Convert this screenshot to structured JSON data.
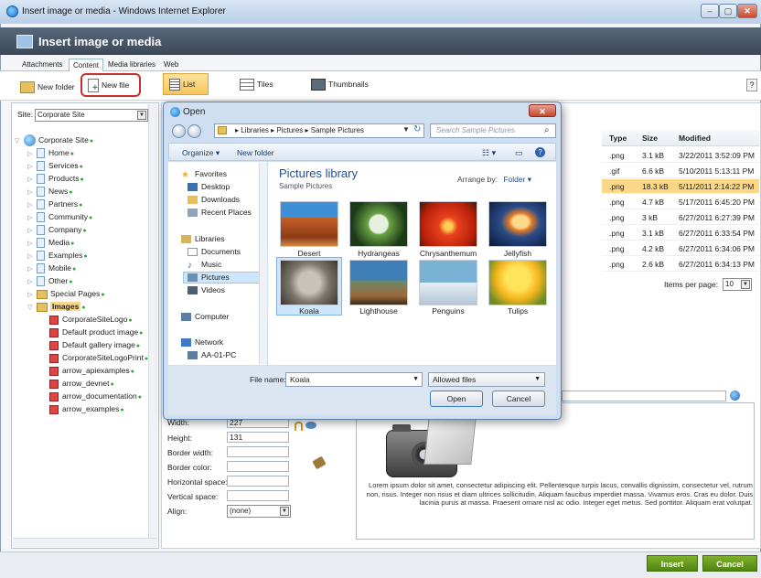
{
  "window": {
    "title": "Insert image or media - Windows Internet Explorer",
    "controls": [
      "–",
      "▢",
      "✕"
    ]
  },
  "dialog": {
    "title": "Insert image or media"
  },
  "tabs": [
    "Attachments",
    "Content",
    "Media libraries",
    "Web"
  ],
  "toolbar": {
    "new_folder": "New folder",
    "new_file": "New file",
    "list": "List",
    "tiles": "Tiles",
    "thumbnails": "Thumbnails",
    "help": "?"
  },
  "site": {
    "label": "Site:",
    "value": "Corporate Site"
  },
  "tree": {
    "root": "Corporate Site",
    "items": [
      "Home",
      "Services",
      "Products",
      "News",
      "Partners",
      "Community",
      "Company",
      "Media",
      "Examples",
      "Mobile",
      "Other",
      "Special Pages",
      "Images"
    ],
    "images": [
      "CorporateSiteLogo",
      "Default product image",
      "Default gallery image",
      "CorporateSiteLogoPrint",
      "arrow_apiexamples",
      "arrow_devnet",
      "arrow_documentation",
      "arrow_examples"
    ]
  },
  "grid": {
    "headers": {
      "type": "Type",
      "size": "Size",
      "modified": "Modified"
    },
    "rows": [
      {
        "type": ".png",
        "size": "3.1 kB",
        "modified": "3/22/2011 3:52:09 PM"
      },
      {
        "type": ".gif",
        "size": "6.6 kB",
        "modified": "5/10/2011 5:13:11 PM"
      },
      {
        "type": ".png",
        "size": "18.3 kB",
        "modified": "5/11/2011 2:14:22 PM"
      },
      {
        "type": ".png",
        "size": "4.7 kB",
        "modified": "5/17/2011 6:45:20 PM"
      },
      {
        "type": ".png",
        "size": "3 kB",
        "modified": "6/27/2011 6:27:39 PM"
      },
      {
        "type": ".png",
        "size": "3.1 kB",
        "modified": "6/27/2011 6:33:54 PM"
      },
      {
        "type": ".png",
        "size": "4.2 kB",
        "modified": "6/27/2011 6:34:06 PM"
      },
      {
        "type": ".png",
        "size": "2.6 kB",
        "modified": "6/27/2011 6:34:13 PM"
      }
    ],
    "items_per_page_label": "Items per page:",
    "items_per_page": "10"
  },
  "props": {
    "width_label": "Width:",
    "width": "227",
    "height_label": "Height:",
    "height": "131",
    "border_width_label": "Border width:",
    "border_color_label": "Border color:",
    "hspace_label": "Horizontal space:",
    "vspace_label": "Vertical space:",
    "align_label": "Align:",
    "align": "(none)"
  },
  "preview_text": "Lorem ipsum dolor sit amet, consectetur adipiscing elit. Pellentesque turpis lacus, convallis dignissim, consectetur vel, rutrum non, risus. Integer non risus et diam ultrices sollicitudin. Aliquam faucibus imperdiet massa. Vivamus eros. Cras eu dolor. Duis lacinia purus at massa. Praesent ornare nisl ac odio. Integer eget metus. Sed porttitor. Aliquam erat volutpat.",
  "footer": {
    "insert": "Insert",
    "cancel": "Cancel"
  },
  "open_dialog": {
    "title": "Open",
    "address": "▸ Libraries ▸ Pictures ▸ Sample Pictures",
    "search_placeholder": "Search Sample Pictures",
    "organize": "Organize ▾",
    "new_folder": "New folder",
    "nav": {
      "favorites": "Favorites",
      "desktop": "Desktop",
      "downloads": "Downloads",
      "recent": "Recent Places",
      "libraries": "Libraries",
      "documents": "Documents",
      "music": "Music",
      "pictures": "Pictures",
      "videos": "Videos",
      "computer": "Computer",
      "network": "Network",
      "pc": "AA-01-PC"
    },
    "library_title": "Pictures library",
    "library_sub": "Sample Pictures",
    "arrange_label": "Arrange by:",
    "arrange_value": "Folder ▾",
    "files": [
      "Desert",
      "Hydrangeas",
      "Chrysanthemum",
      "Jellyfish",
      "Koala",
      "Lighthouse",
      "Penguins",
      "Tulips"
    ],
    "file_name_label": "File name:",
    "file_name": "Koala",
    "file_type": "Allowed files",
    "open": "Open",
    "cancel": "Cancel"
  },
  "colors": {
    "header": "#3b4858",
    "selected_row": "#fbd887",
    "insert_green": "#5a8f16",
    "red_highlight": "#c4302b"
  }
}
